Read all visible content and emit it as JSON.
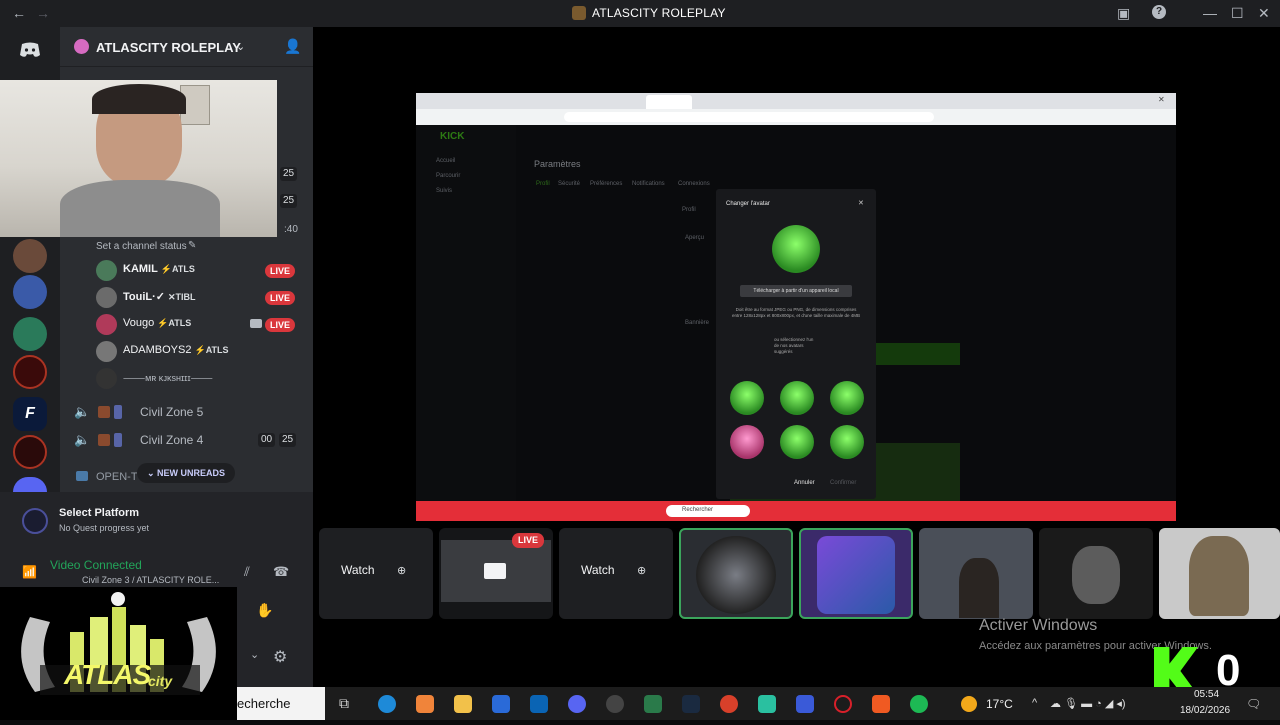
{
  "window": {
    "title": "ATLASCITY ROLEPLAY"
  },
  "server": {
    "name": "ATLASCITY ROLEPLAY"
  },
  "rail": {
    "discord_icon": "discord-icon"
  },
  "channel_status": "Set a channel status",
  "stage_counts": [
    "25",
    "25",
    ":40"
  ],
  "voice_users": [
    {
      "name": "KAMIL",
      "tag": "ATLS",
      "live": "LIVE",
      "color": "#4a7a5a"
    },
    {
      "name": "TouiL·✓",
      "tag": "TIBL",
      "live": "LIVE",
      "color": "#6b6b6b"
    },
    {
      "name": "Vougo",
      "tag": "ATLS",
      "live": "LIVE",
      "color": "#b03a5a"
    },
    {
      "name": "ADAMBOYS2",
      "tag": "ATLS",
      "live": "",
      "color": "#777777"
    },
    {
      "name": "⸻ᴍʀ ᴋᴊᴋsʜɪɪɪ⸻",
      "tag": "",
      "live": "",
      "color": "#333333"
    }
  ],
  "channels": [
    {
      "name": "Civil Zone 5"
    },
    {
      "name": "Civil Zone 4",
      "count_a": "00",
      "count_b": "25"
    }
  ],
  "open_channel": "OPEN-T",
  "new_unreads": "NEW UNREADS",
  "quest": {
    "title": "Select Platform",
    "subtitle": "No Quest progress yet"
  },
  "voice_status": {
    "title": "Video Connected",
    "subtitle": "Civil Zone 3 / ATLASCITY ROLE..."
  },
  "browser": {
    "site_logo": "KICK",
    "page_title": "Paramètres",
    "tabs": [
      "Profil",
      "Sécurité",
      "Préférences",
      "Notifications",
      "Connexions"
    ],
    "side_items": [
      "Accueil",
      "Parcourir",
      "Suivis"
    ],
    "section_profile": "Profil",
    "section_apercu": "Aperçu",
    "section_banniere": "Bannière",
    "modal": {
      "title": "Changer l'avatar",
      "upload_button": "Télécharger à partir d'un appareil local",
      "info": "Doit être au format JPEG ou PNG, de dimensions comprises entre 128x128px et 800x800px, et d'une taille maximale de 4MB",
      "or_label": "ou sélectionnez l'un de nos avatars suggérés",
      "cancel": "Annuler",
      "confirm": "Confirmer"
    },
    "os_search": "Rechercher"
  },
  "tiles": [
    {
      "label": "Watch",
      "live": ""
    },
    {
      "label": "",
      "live": "LIVE"
    },
    {
      "label": "Watch",
      "live": ""
    }
  ],
  "watermark": {
    "title": "Activer Windows",
    "subtitle": "Accédez aux paramètres pour activer Windows."
  },
  "taskbar": {
    "search": "echerche",
    "weather": "17°C",
    "time": "05:54",
    "date": "18/02/2026"
  },
  "overlay": {
    "letter": "K",
    "count": "0"
  },
  "colors": {
    "live_red": "#da373c",
    "kick_green": "#53fc18",
    "discord_bg": "#2b2d31",
    "selected_border": "#3ba55c"
  }
}
